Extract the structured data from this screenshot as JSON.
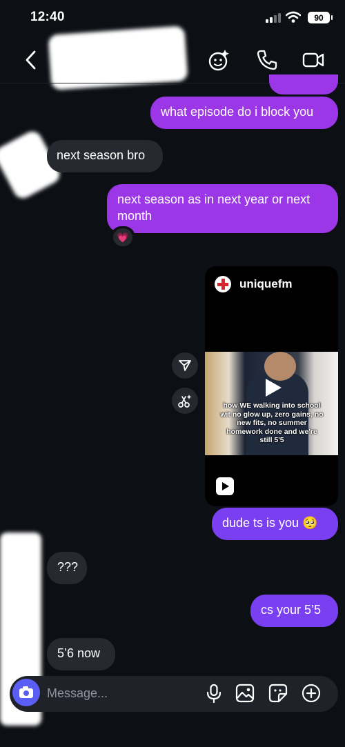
{
  "status": {
    "time": "12:40",
    "battery": "90"
  },
  "header": {
    "contact_name": ""
  },
  "messages": {
    "m1": "what episode do i block you",
    "m2": "next season bro",
    "m3": "next season as in next year or next month",
    "m3_reaction": "💗",
    "m4": "dude ts is you 🥺",
    "m5": "???",
    "m6": "cs your 5’5",
    "m7": "5’6 now"
  },
  "shared_post": {
    "username": "uniquefm",
    "caption": "how WE walking into school wit no glow up, zero gains, no new fits, no summer homework done and we're still 5'5"
  },
  "composer": {
    "placeholder": "Message..."
  }
}
